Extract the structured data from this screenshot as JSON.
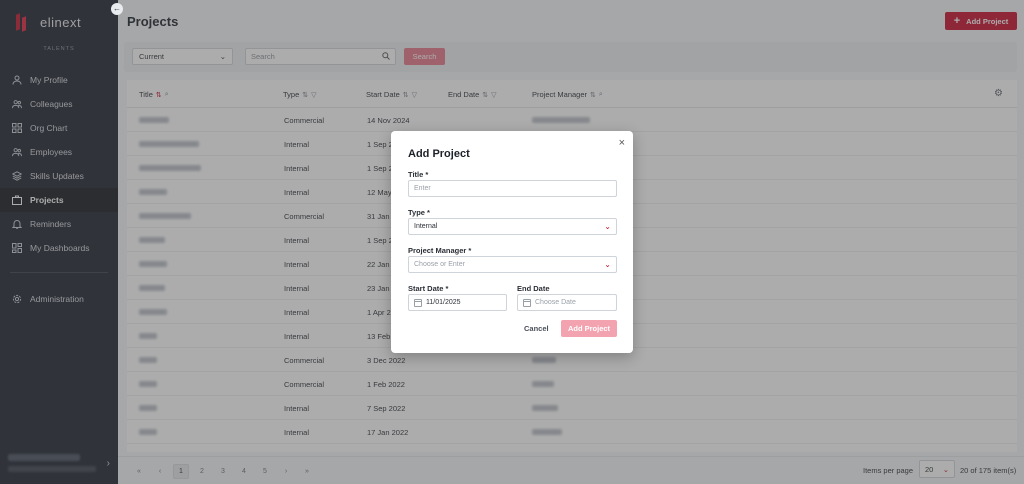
{
  "sidebar": {
    "brand": "elinext",
    "section": "TALENTS",
    "items": [
      {
        "label": "My Profile",
        "icon": "user-icon"
      },
      {
        "label": "Colleagues",
        "icon": "users-icon"
      },
      {
        "label": "Org Chart",
        "icon": "grid-icon"
      },
      {
        "label": "Employees",
        "icon": "users-icon"
      },
      {
        "label": "Skills Updates",
        "icon": "layers-icon"
      },
      {
        "label": "Projects",
        "icon": "briefcase-icon",
        "active": true
      },
      {
        "label": "Reminders",
        "icon": "bell-icon"
      },
      {
        "label": "My Dashboards",
        "icon": "dashboard-icon"
      }
    ],
    "admin": {
      "label": "Administration",
      "icon": "gear-icon"
    }
  },
  "header": {
    "title": "Projects",
    "add_button": "Add Project"
  },
  "filters": {
    "status_value": "Current",
    "search_placeholder": "Search",
    "search_button": "Search"
  },
  "table": {
    "columns": [
      "Title",
      "Type",
      "Start Date",
      "End Date",
      "Project Manager"
    ],
    "rows": [
      {
        "type": "Commercial",
        "start": "14 Nov 2024"
      },
      {
        "type": "Internal",
        "start": "1 Sep 2"
      },
      {
        "type": "Internal",
        "start": "1 Sep 2"
      },
      {
        "type": "Internal",
        "start": "12 May"
      },
      {
        "type": "Commercial",
        "start": "31 Jan"
      },
      {
        "type": "Internal",
        "start": "1 Sep 2"
      },
      {
        "type": "Internal",
        "start": "22 Jan"
      },
      {
        "type": "Internal",
        "start": "23 Jan"
      },
      {
        "type": "Internal",
        "start": "1 Apr 2"
      },
      {
        "type": "Internal",
        "start": "13 Feb"
      },
      {
        "type": "Commercial",
        "start": "3 Dec 2022"
      },
      {
        "type": "Commercial",
        "start": "1 Feb 2022"
      },
      {
        "type": "Internal",
        "start": "7 Sep 2022"
      },
      {
        "type": "Internal",
        "start": "17 Jan 2022"
      }
    ]
  },
  "pagination": {
    "pages": [
      "1",
      "2",
      "3",
      "4",
      "5"
    ],
    "first": "«",
    "prev": "‹",
    "next": "›",
    "last": "»",
    "items_per_page_label": "Items per page",
    "items_per_page_value": "20",
    "total": "20 of 175 item(s)"
  },
  "modal": {
    "title": "Add Project",
    "close": "×",
    "title_label": "Title *",
    "title_placeholder": "Enter",
    "type_label": "Type *",
    "type_value": "Internal",
    "pm_label": "Project Manager *",
    "pm_placeholder": "Choose or Enter",
    "start_label": "Start Date *",
    "start_value": "11/01/2025",
    "end_label": "End Date",
    "end_placeholder": "Choose Date",
    "cancel": "Cancel",
    "submit": "Add Project"
  },
  "colors": {
    "accent": "#c8102e",
    "sidebar": "#1f2430"
  }
}
